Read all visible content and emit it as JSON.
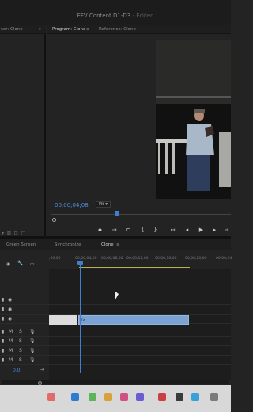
{
  "window": {
    "title": "EFV Content D1-D3",
    "status": "- Edited"
  },
  "tabs": {
    "source": "ser: Clone",
    "program": "Program: Clone",
    "reference": "Reference: Clone"
  },
  "program_monitor": {
    "timecode": "00;00;04;08",
    "zoom": "Fit",
    "controls": [
      "marker",
      "in-point",
      "out-point",
      "go-to-in",
      "go-to-out",
      "step-back",
      "play",
      "step-forward",
      "go-to-end"
    ]
  },
  "timeline": {
    "tabs": [
      "Green Screen",
      "Synchronize",
      "Clone"
    ],
    "active_tab": "Clone",
    "ruler_ticks": [
      ";00;00",
      "00;00;04;00",
      "00;00;08;00",
      "00;00;12;00",
      "00;00;16;00",
      "00;00;20;00",
      "00;00;24"
    ],
    "video_tracks": 3,
    "audio_tracks": 4,
    "mix_value": "0.0",
    "clip_label": "fx"
  },
  "colors": {
    "accent": "#3d7fd0",
    "clip": "#7aa2d2",
    "panel": "#232323"
  }
}
